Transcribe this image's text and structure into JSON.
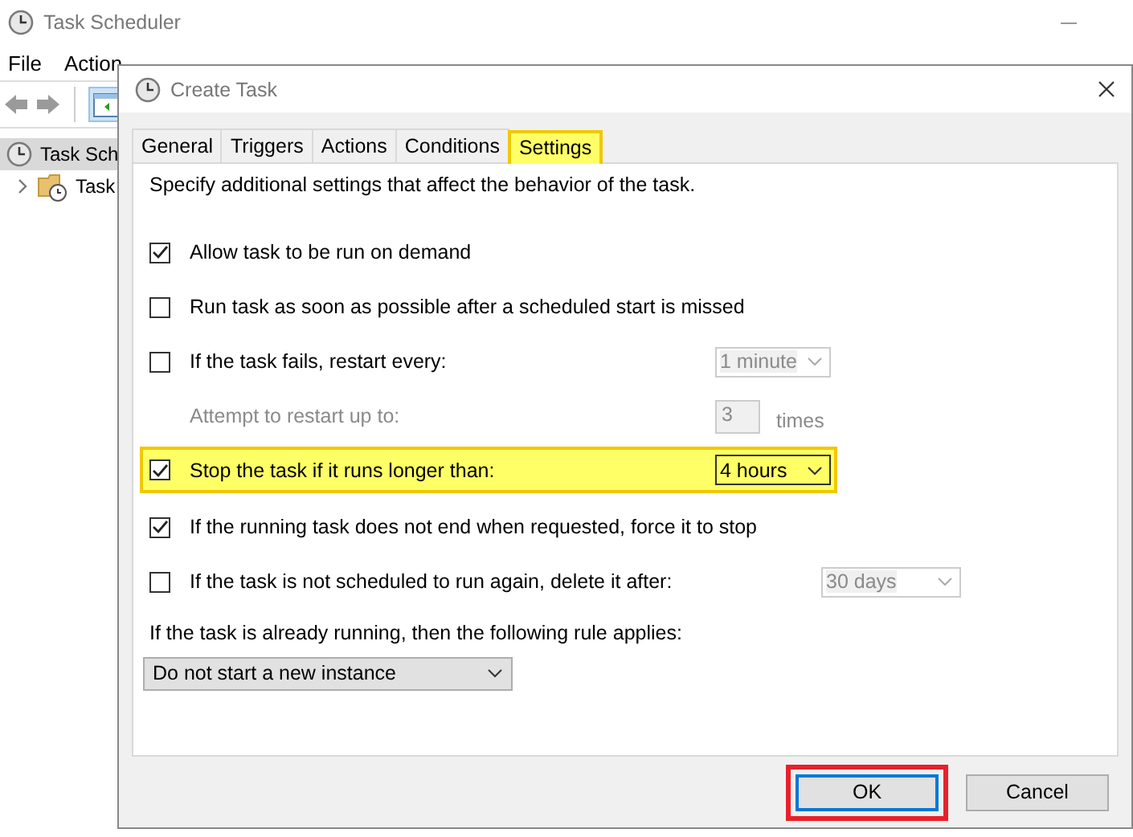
{
  "background_window": {
    "title": "Task Scheduler",
    "menu": [
      "File",
      "Action"
    ],
    "tree": [
      {
        "label": "Task Sch",
        "selected": true,
        "children": [
          {
            "label": "Task",
            "expanded": false
          }
        ]
      }
    ]
  },
  "dialog": {
    "title": "Create Task",
    "tabs": [
      {
        "label": "General",
        "selected": false,
        "highlighted": false
      },
      {
        "label": "Triggers",
        "selected": false,
        "highlighted": false
      },
      {
        "label": "Actions",
        "selected": false,
        "highlighted": false
      },
      {
        "label": "Conditions",
        "selected": false,
        "highlighted": false
      },
      {
        "label": "Settings",
        "selected": true,
        "highlighted": true
      }
    ],
    "description": "Specify additional settings that affect the behavior of the task.",
    "settings": [
      {
        "kind": "checkbox",
        "label": "Allow task to be run on demand",
        "checked": true,
        "highlighted": false
      },
      {
        "kind": "checkbox",
        "label": "Run task as soon as possible after a scheduled start is missed",
        "checked": false,
        "highlighted": false
      },
      {
        "kind": "checkbox",
        "label": "If the task fails, restart every:",
        "checked": false,
        "highlighted": false,
        "dropdown": {
          "value": "1 minute",
          "disabled": true
        }
      },
      {
        "kind": "number",
        "label": "Attempt to restart up to:",
        "value": "3",
        "unit": "times",
        "disabled": true
      },
      {
        "kind": "checkbox",
        "label": "Stop the task if it runs longer than:",
        "checked": true,
        "highlighted": true,
        "dropdown": {
          "value": "4 hours",
          "disabled": false
        }
      },
      {
        "kind": "checkbox",
        "label": "If the running task does not end when requested, force it to stop",
        "checked": true,
        "highlighted": false
      },
      {
        "kind": "checkbox",
        "label": "If the task is not scheduled to run again, delete it after:",
        "checked": false,
        "highlighted": false,
        "dropdown": {
          "value": "30 days",
          "disabled": true
        }
      },
      {
        "kind": "label",
        "label": "If the task is already running, then the following rule applies:"
      },
      {
        "kind": "select",
        "value": "Do not start a new instance"
      }
    ],
    "buttons": [
      {
        "label": "OK",
        "highlighted": true
      },
      {
        "label": "Cancel",
        "highlighted": false
      }
    ]
  }
}
